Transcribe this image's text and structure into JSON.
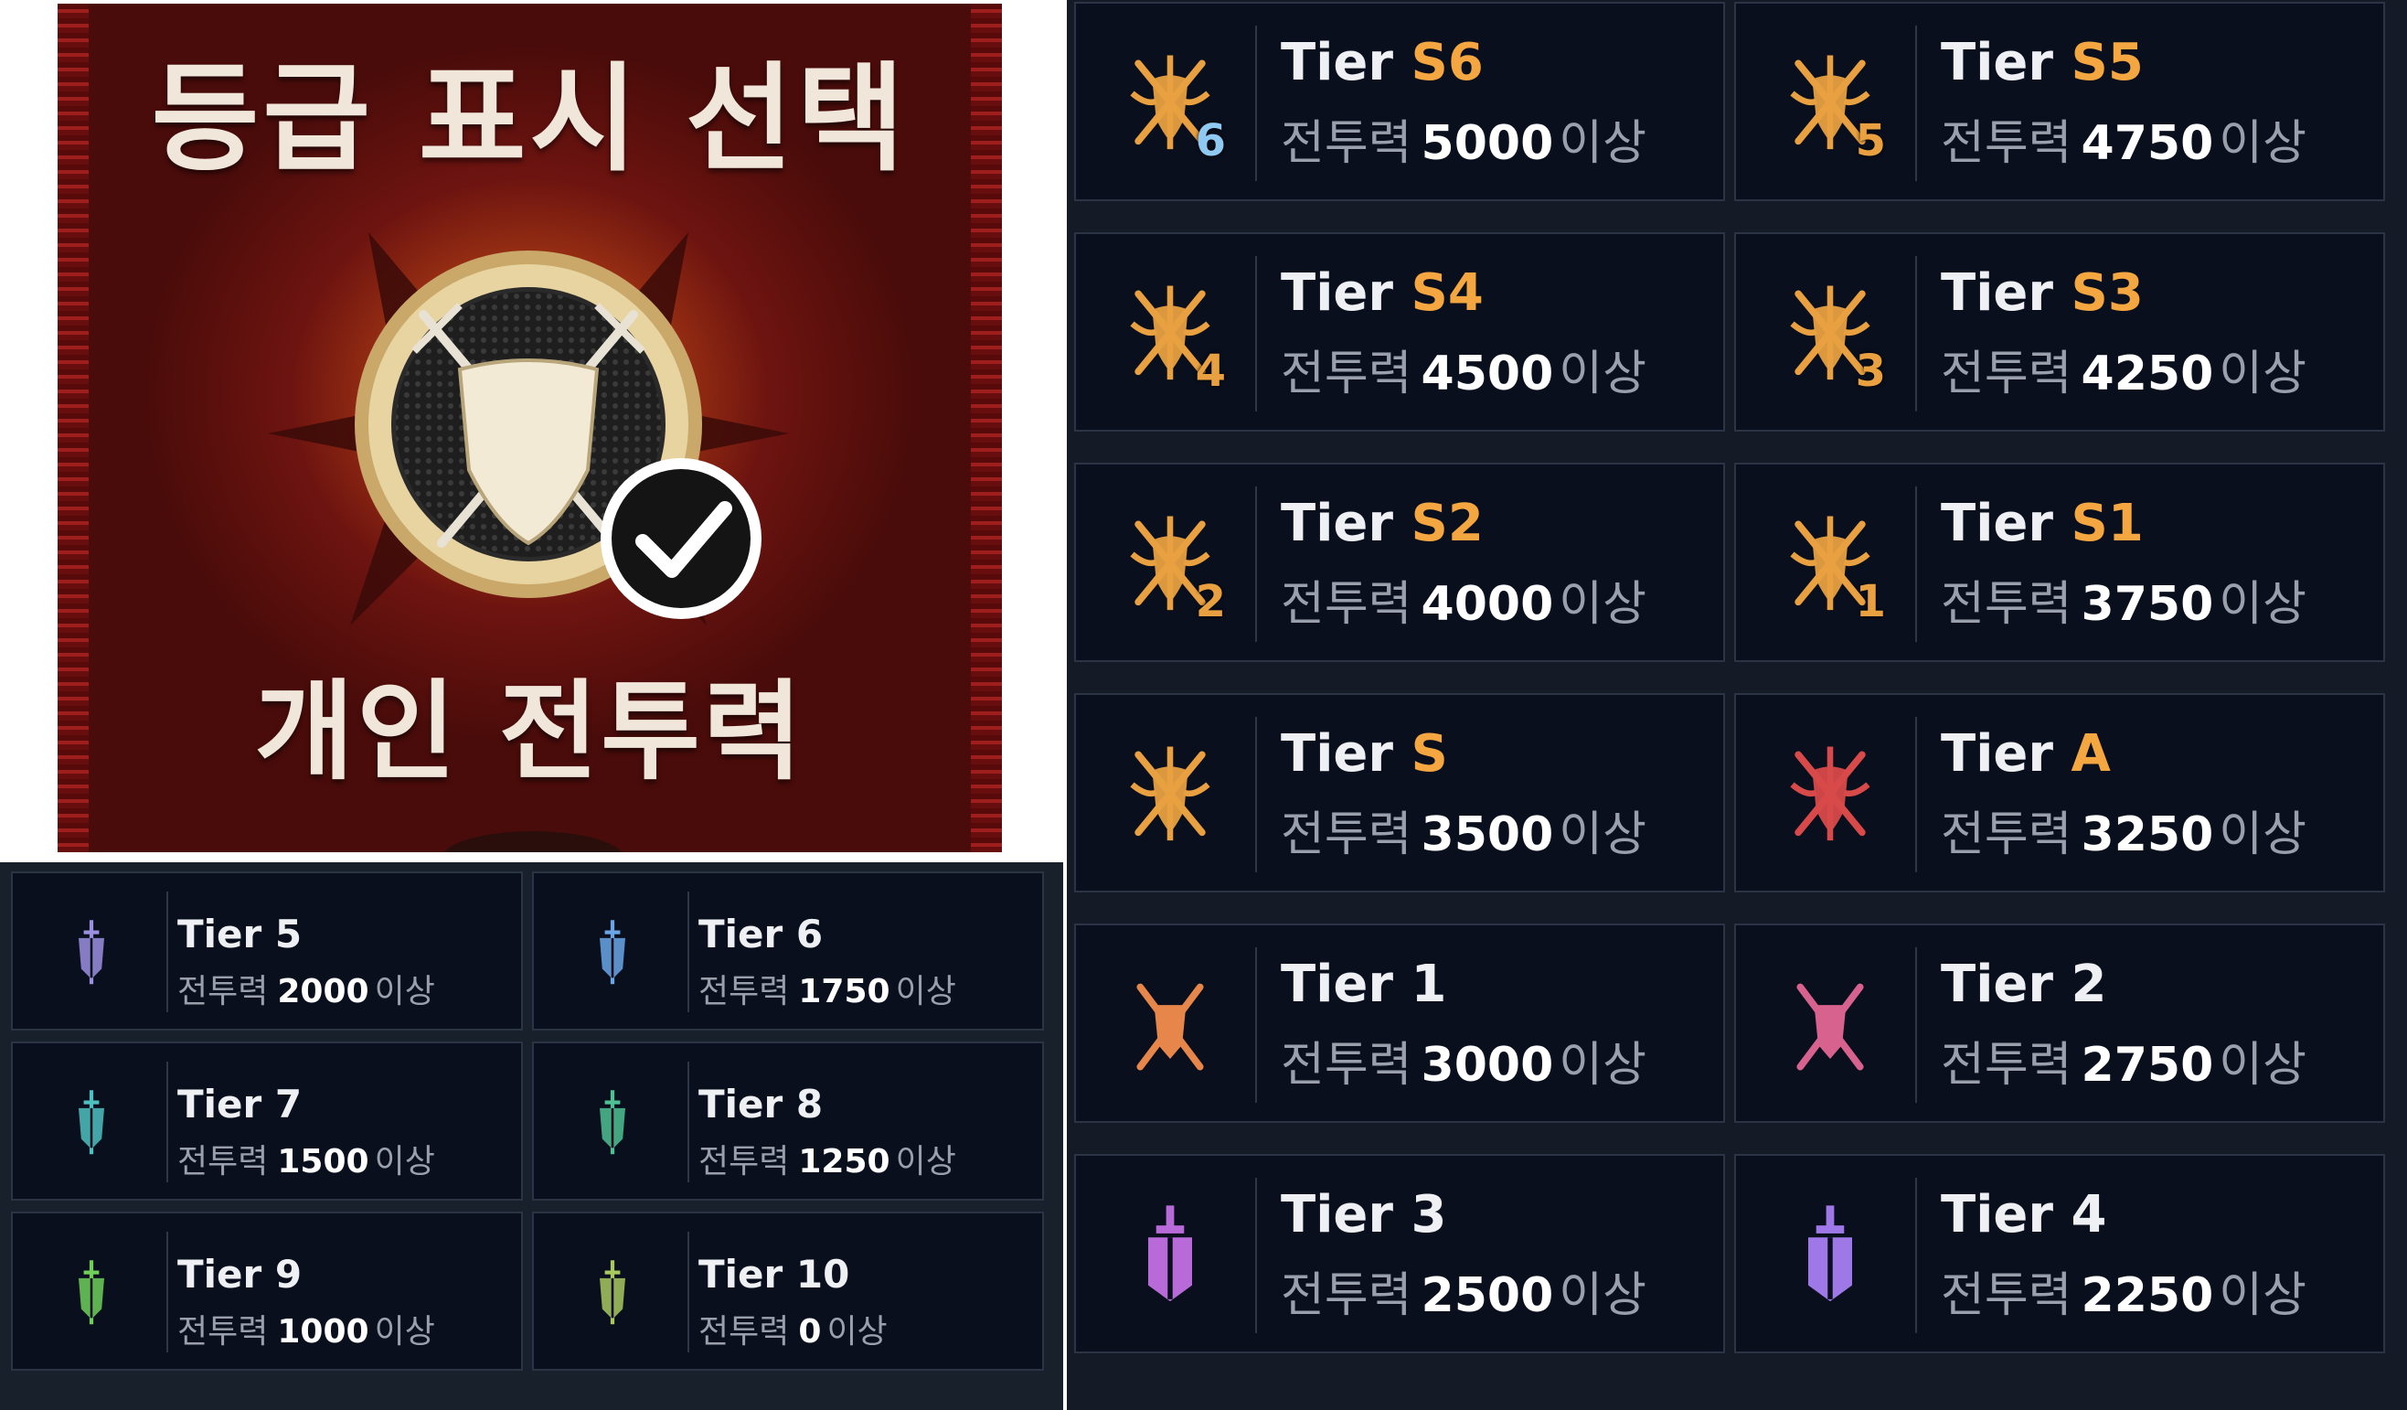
{
  "banner": {
    "title": "등급 표시 선택",
    "subtitle": "개인 전투력"
  },
  "labels": {
    "power": "전투력",
    "suffix": "이상",
    "tier_prefix": "Tier"
  },
  "left_panel": {
    "cards": [
      {
        "grade": "5",
        "power": "2000",
        "icon": "tier-5-icon",
        "color": "#9b8fe0"
      },
      {
        "grade": "6",
        "power": "1750",
        "icon": "tier-6-icon",
        "color": "#6aa6e6"
      },
      {
        "grade": "7",
        "power": "1500",
        "icon": "tier-7-icon",
        "color": "#4fc0c0"
      },
      {
        "grade": "8",
        "power": "1250",
        "icon": "tier-8-icon",
        "color": "#4fc093"
      },
      {
        "grade": "9",
        "power": "1000",
        "icon": "tier-9-icon",
        "color": "#6fcf5a"
      },
      {
        "grade": "10",
        "power": "0",
        "icon": "tier-10-icon",
        "color": "#a8c860"
      }
    ]
  },
  "right_panel": {
    "cards": [
      {
        "grade": "S6",
        "power": "5000",
        "icon": "tier-s6-icon",
        "color": "#e8a040",
        "badge": "6",
        "badge_color": "#8fc8f0"
      },
      {
        "grade": "S5",
        "power": "4750",
        "icon": "tier-s5-icon",
        "color": "#e8a040",
        "badge": "5",
        "badge_color": "#e8a040"
      },
      {
        "grade": "S4",
        "power": "4500",
        "icon": "tier-s4-icon",
        "color": "#e8a040",
        "badge": "4",
        "badge_color": "#e8a040"
      },
      {
        "grade": "S3",
        "power": "4250",
        "icon": "tier-s3-icon",
        "color": "#e8a040",
        "badge": "3",
        "badge_color": "#e8a040"
      },
      {
        "grade": "S2",
        "power": "4000",
        "icon": "tier-s2-icon",
        "color": "#e8a040",
        "badge": "2",
        "badge_color": "#e8a040"
      },
      {
        "grade": "S1",
        "power": "3750",
        "icon": "tier-s1-icon",
        "color": "#e8a040",
        "badge": "1",
        "badge_color": "#e8a040"
      },
      {
        "grade": "S",
        "power": "3500",
        "icon": "tier-s-icon",
        "color": "#e8a040",
        "badge": "",
        "badge_color": "#e8a040"
      },
      {
        "grade": "A",
        "power": "3250",
        "icon": "tier-a-icon",
        "color": "#d84a4a",
        "badge": "",
        "badge_color": "#d84a4a"
      },
      {
        "grade": "1",
        "power": "3000",
        "icon": "tier-1-icon",
        "color": "#e6864a",
        "badge": "",
        "badge_color": ""
      },
      {
        "grade": "2",
        "power": "2750",
        "icon": "tier-2-icon",
        "color": "#d8628e",
        "badge": "",
        "badge_color": ""
      },
      {
        "grade": "3",
        "power": "2500",
        "icon": "tier-3-icon",
        "color": "#b86ad8",
        "badge": "",
        "badge_color": ""
      },
      {
        "grade": "4",
        "power": "2250",
        "icon": "tier-4-icon",
        "color": "#9e78e6",
        "badge": "",
        "badge_color": ""
      }
    ]
  }
}
